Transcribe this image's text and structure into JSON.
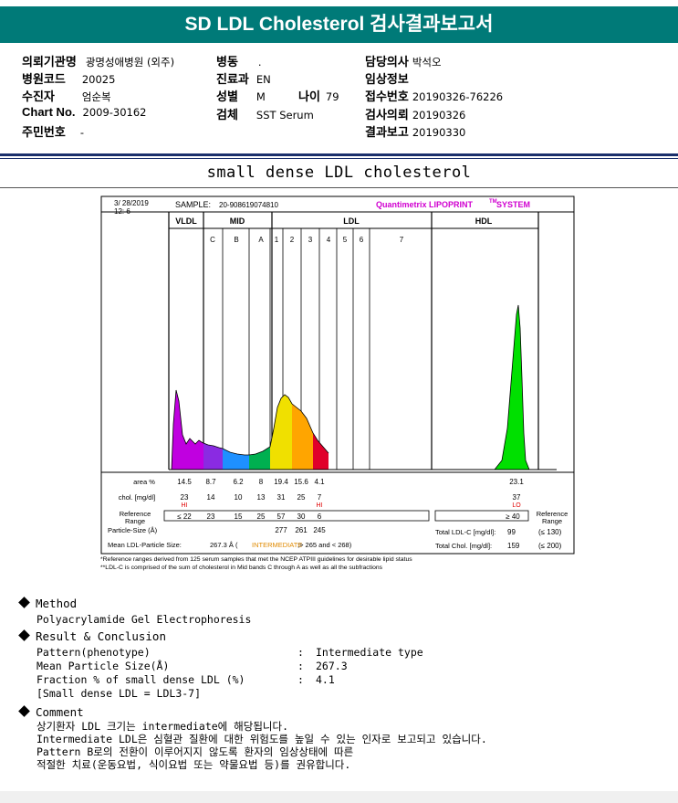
{
  "report": {
    "title": "SD LDL Cholesterol 검사결과보고서",
    "fields_left": [
      {
        "label": "의뢰기관명",
        "value": "광명성애병원 (외주)"
      },
      {
        "label": "병원코드",
        "value": "20025"
      },
      {
        "label": "수진자",
        "value": "엄순복"
      },
      {
        "label": "Chart No.",
        "value": "2009-30162"
      },
      {
        "label": "주민번호",
        "value": "-"
      }
    ],
    "fields_mid": [
      {
        "label": "병동",
        "value": "."
      },
      {
        "label": "진료과",
        "value": "EN"
      },
      {
        "label": "성별",
        "value": "M"
      },
      {
        "label": "검체",
        "value": "SST Serum"
      }
    ],
    "age": {
      "label": "나이",
      "value": "79"
    },
    "fields_right": [
      {
        "label": "담당의사",
        "value": "박석오"
      },
      {
        "label": "임상정보",
        "value": ""
      },
      {
        "label": "접수번호",
        "value": "20190326-76226"
      },
      {
        "label": "검사의뢰",
        "value": "20190326"
      },
      {
        "label": "결과보고",
        "value": "20190330"
      }
    ]
  },
  "subtitle": "small dense LDL cholesterol",
  "chart_data": {
    "type": "area",
    "header": {
      "datetime_line1": "3/ 28/2019",
      "datetime_line2": "12: 6",
      "sample_label": "SAMPLE:",
      "sample_id": "20-908619074810",
      "brand": "Quantimetrix LIPOPRINT",
      "brand_tm": "TM",
      "brand_suffix": "SYSTEM"
    },
    "groups": [
      "VLDL",
      "MID",
      "LDL",
      "HDL"
    ],
    "bands": [
      "C",
      "B",
      "A",
      "1",
      "2",
      "3",
      "4",
      "5",
      "6",
      "7"
    ],
    "series": [
      {
        "band": "VLDL",
        "area_pct": 14.5,
        "chol": 23,
        "flag": "HI",
        "ref": "≤ 22",
        "color": "#c000e0"
      },
      {
        "band": "C",
        "area_pct": 8.7,
        "chol": 14,
        "flag": "",
        "ref": "23",
        "color": "#8a2be2"
      },
      {
        "band": "B",
        "area_pct": 6.2,
        "chol": 10,
        "flag": "",
        "ref": "15",
        "color": "#1e90ff"
      },
      {
        "band": "A",
        "area_pct": 8.0,
        "chol": 13,
        "flag": "",
        "ref": "25",
        "color": "#00b050"
      },
      {
        "band": "1",
        "area_pct": 19.4,
        "chol": 31,
        "flag": "",
        "ref": "57",
        "color": "#f0e000"
      },
      {
        "band": "2",
        "area_pct": 15.6,
        "chol": 25,
        "flag": "",
        "ref": "30",
        "color": "#ffa500"
      },
      {
        "band": "3",
        "area_pct": 4.1,
        "chol": 7,
        "flag": "HI",
        "ref": "6",
        "color": "#e0002a"
      },
      {
        "band": "HDL",
        "area_pct": 23.1,
        "chol": 37,
        "flag": "LO",
        "ref": "≥ 40",
        "color": "#00e000"
      }
    ],
    "row_labels": {
      "area": "area %",
      "chol": "chol. [mg/dl]",
      "reference_range": "Reference Range",
      "reference_range_right": "Reference Range",
      "particle_size": "Particle-Size (Å)",
      "mean_ldl_size": "Mean LDL-Particle Size:"
    },
    "particle_sizes": [
      "277",
      "261",
      "245"
    ],
    "mean_ldl_value": "267.3 Å",
    "mean_ldl_class": "INTERMEDIATE",
    "mean_ldl_tail": ";> 265 and < 268)",
    "total_ldl": {
      "label": "Total LDL-C [mg/dl]:",
      "value": "99",
      "ref": "(≤ 130)"
    },
    "total_chol": {
      "label": "Total Chol. [mg/dl]:",
      "value": "159",
      "ref": "(≤ 200)"
    },
    "footnotes": [
      "*Reference ranges derived from 125 serum samples that met the NCEP ATPIII guidelines for desirable lipid status",
      "**LDL-C is comprised of the sum of cholesterol in Mid bands C through A as well as all the subfractions"
    ]
  },
  "method": {
    "heading": "Method",
    "text": "Polyacrylamide Gel Electrophoresis"
  },
  "result": {
    "heading": "Result & Conclusion",
    "rows": [
      {
        "label": "Pattern(phenotype)",
        "value": "Intermediate type"
      },
      {
        "label": "Mean Particle Size(Å)",
        "value": "267.3"
      },
      {
        "label": "Fraction % of small dense LDL (%)",
        "value": "4.1"
      }
    ],
    "note": "[Small dense LDL = LDL3-7]"
  },
  "comment": {
    "heading": "Comment",
    "lines": [
      "상기환자 LDL 크기는 intermediate에 해당됩니다.",
      "Intermediate LDL은 심혈관 질환에 대한 위험도를 높일 수 있는 인자로 보고되고 있습니다.",
      "Pattern B로의 전환이 이루어지지 않도록 환자의 임상상태에 따른",
      "적절한 치료(운동요법, 식이요법 또는 약물요법 등)를 권유합니다."
    ]
  }
}
